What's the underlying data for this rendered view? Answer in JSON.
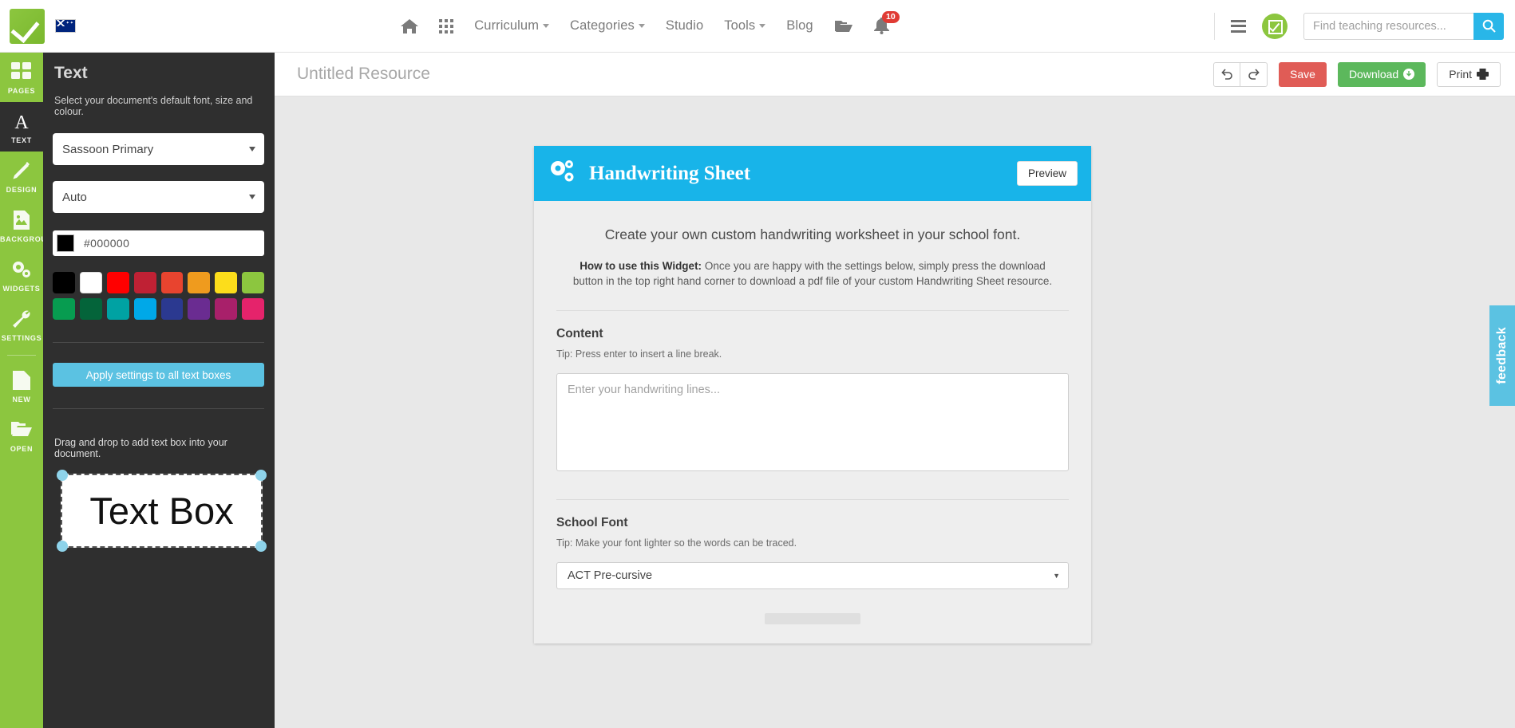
{
  "topnav": {
    "logo_name": "teach-starter-logo",
    "flag": "australian-flag",
    "links": [
      {
        "label": "Curriculum",
        "caret": true
      },
      {
        "label": "Categories",
        "caret": true
      },
      {
        "label": "Studio",
        "caret": false
      },
      {
        "label": "Tools",
        "caret": true
      },
      {
        "label": "Blog",
        "caret": false
      }
    ],
    "notification_count": "10",
    "search": {
      "placeholder": "Find teaching resources...",
      "value": ""
    }
  },
  "rail": {
    "items": [
      {
        "label": "PAGES",
        "icon": "pages-icon",
        "active": false
      },
      {
        "label": "TEXT",
        "icon": "text-icon",
        "active": true
      },
      {
        "label": "DESIGN",
        "icon": "pencil-icon",
        "active": false
      },
      {
        "label": "BACKGROUND",
        "icon": "image-icon",
        "active": false
      },
      {
        "label": "WIDGETS",
        "icon": "gears-icon",
        "active": false
      },
      {
        "label": "SETTINGS",
        "icon": "wrench-icon",
        "active": false
      },
      {
        "label": "NEW",
        "icon": "new-file-icon",
        "active": false
      },
      {
        "label": "OPEN",
        "icon": "folder-open-icon",
        "active": false
      }
    ]
  },
  "panel": {
    "title": "Text",
    "subtitle": "Select your document's default font, size and colour.",
    "font_select": "Sassoon Primary",
    "size_select": "Auto",
    "color_hex": "#000000",
    "color_chip": "#000000",
    "swatches": [
      "#000000",
      "#ffffff",
      "#ff0000",
      "#bf2134",
      "#e8442f",
      "#ef9b1e",
      "#fcdd1b",
      "#8cc63f",
      "#079c50",
      "#04643a",
      "#00a2a3",
      "#00a8e8",
      "#2b3990",
      "#6a2c91",
      "#a8206a",
      "#e5236b"
    ],
    "apply_label": "Apply settings to all text boxes",
    "drag_hint": "Drag and drop to add text box into your document.",
    "textbox_label": "Text Box"
  },
  "editor": {
    "doc_title": "Untitled Resource",
    "undo_label": "undo",
    "redo_label": "redo",
    "save_label": "Save",
    "download_label": "Download",
    "print_label": "Print"
  },
  "widget": {
    "title": "Handwriting Sheet",
    "preview_label": "Preview",
    "lead": "Create your own custom handwriting worksheet in your school font.",
    "howto_bold": "How to use this Widget:",
    "howto_text": " Once you are happy with the settings below, simply press the download button in the top right hand corner to download a pdf file of your custom Handwriting Sheet resource.",
    "content": {
      "label": "Content",
      "tip": "Tip: Press enter to insert a line break.",
      "placeholder": "Enter your handwriting lines...",
      "value": ""
    },
    "school_font": {
      "label": "School Font",
      "tip": "Tip: Make your font lighter so the words can be traced.",
      "selected": "ACT Pre-cursive"
    }
  },
  "feedback": {
    "label": "feedback"
  },
  "colors": {
    "brand_green": "#8cc63f",
    "panel_dark": "#2f2f2f",
    "widget_blue": "#18b4e9",
    "accent_blue": "#5bc2e2",
    "save_red": "#e05c56",
    "download_green": "#5cb85c"
  }
}
